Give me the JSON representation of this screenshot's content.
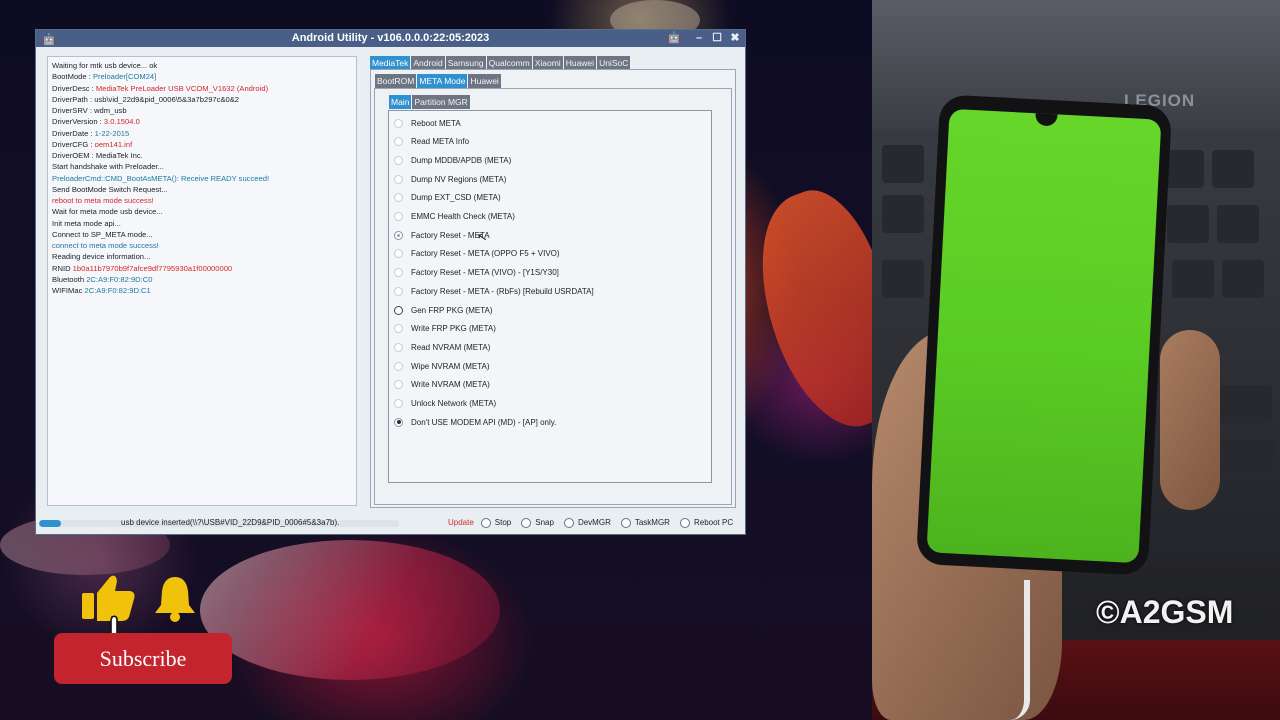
{
  "window": {
    "title": "Android Utility - v106.0.0.0:22:05:2023",
    "controls": [
      "–",
      "☐",
      "✖"
    ]
  },
  "log": [
    {
      "label": "Waiting for mtk usb device... ok",
      "value": "",
      "color": "dark"
    },
    {
      "label": "BootMode : ",
      "value": "Preloader[COM24]",
      "color": "blue"
    },
    {
      "label": "DriverDesc : ",
      "value": "MediaTek PreLoader USB VCOM_V1632 (Android)",
      "color": "red"
    },
    {
      "label": "DriverPath : ",
      "value": "usb\\vid_22d9&pid_0006\\5&3a7b297c&0&2",
      "color": "dark"
    },
    {
      "label": "DriverSRV : ",
      "value": "wdm_usb",
      "color": "dark"
    },
    {
      "label": "DriverVersion : ",
      "value": "3.0.1504.0",
      "color": "red"
    },
    {
      "label": "DriverDate : ",
      "value": "1-22-2015",
      "color": "blue"
    },
    {
      "label": "DriverCFG : ",
      "value": "oem141.inf",
      "color": "red"
    },
    {
      "label": "DriverOEM : ",
      "value": "MediaTek Inc.",
      "color": "dark"
    },
    {
      "label": "Start handshake with Preloader...",
      "value": "",
      "color": "dark"
    },
    {
      "label": "",
      "value": "PreloaderCmd::CMD_BootAsMETA(): Receive READY succeed!",
      "color": "blue"
    },
    {
      "label": "Send BootMode Switch Request...",
      "value": "",
      "color": "dark"
    },
    {
      "label": "",
      "value": "reboot to meta mode success!",
      "color": "red"
    },
    {
      "label": "Wait for meta mode usb device...",
      "value": "",
      "color": "dark"
    },
    {
      "label": "Init meta mode api...",
      "value": "",
      "color": "dark"
    },
    {
      "label": "Connect to SP_META mode...",
      "value": "",
      "color": "dark"
    },
    {
      "label": "",
      "value": "connect to meta mode success!",
      "color": "blue"
    },
    {
      "label": "Reading device information...",
      "value": "",
      "color": "dark"
    },
    {
      "label": "RNID ",
      "value": "1b0a11b7970b9f7afce9df7795930a1f00000000",
      "color": "red"
    },
    {
      "label": "Bluetooth ",
      "value": "2C:A9:F0:82:9D:C0",
      "color": "blue"
    },
    {
      "label": "WIFIMac ",
      "value": "2C:A9:F0:82:9D:C1",
      "color": "blue"
    }
  ],
  "tabs_vendor": [
    "MediaTek",
    "Android",
    "Samsung",
    "Qualcomm",
    "Xiaomi",
    "Huawei",
    "UniSoC"
  ],
  "tabs_mode": [
    "BootROM",
    "META Mode",
    "Huawei"
  ],
  "tabs_sub": [
    "Main",
    "Partition MGR"
  ],
  "options": [
    {
      "label": "Reboot META",
      "state": "faint"
    },
    {
      "label": "Read META Info",
      "state": "faint"
    },
    {
      "label": "Dump MDDB/APDB (META)",
      "state": "faint"
    },
    {
      "label": "Dump NV Regions (META)",
      "state": "faint"
    },
    {
      "label": "Dump  EXT_CSD (META)",
      "state": "faint"
    },
    {
      "label": "EMMC Health Check (META)",
      "state": "faint"
    },
    {
      "label": "Factory Reset - META",
      "state": "grey-dot"
    },
    {
      "label": "Factory Reset - META (OPPO F5 + VIVO)",
      "state": "faint"
    },
    {
      "label": "Factory Reset - META (VIVO) - [Y1S/Y30]",
      "state": "faint"
    },
    {
      "label": "Factory Reset - META - (RbFs) [Rebuild USRDATA]",
      "state": "faint"
    },
    {
      "label": "Gen FRP PKG (META)",
      "state": "dark"
    },
    {
      "label": "Write FRP PKG (META)",
      "state": "faint"
    },
    {
      "label": "Read NVRAM (META)",
      "state": "faint"
    },
    {
      "label": "Wipe NVRAM (META)",
      "state": "faint"
    },
    {
      "label": "Write NVRAM (META)",
      "state": "faint"
    },
    {
      "label": "Unlock Network (META)",
      "state": "faint"
    },
    {
      "label": "Don't USE MODEM API (MD) - [AP] only.",
      "state": "checked"
    }
  ],
  "status": {
    "progress": 0.06,
    "text": "usb device inserted(\\\\?\\USB#VID_22D9&PID_0006#5&3a7b).",
    "update_label": "Update",
    "actions": [
      "Stop",
      "Snap",
      "DevMGR",
      "TaskMGR",
      "Reboot PC"
    ]
  },
  "overlay": {
    "subscribe_label": "Subscribe",
    "copyright": "©A2GSM",
    "laptop_brand": "LEGION"
  },
  "colors": {
    "titlebar": "#4a5f88",
    "accent_tab": "#2f91cf",
    "log_red": "#d12a2a",
    "log_blue": "#1e7aa0",
    "subscribe": "#c4242d",
    "phone_screen": "#5bcc24"
  }
}
